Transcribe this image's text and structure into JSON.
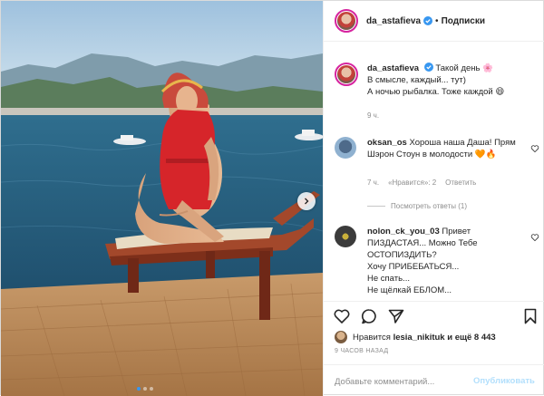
{
  "post": {
    "username": "da_astafieva",
    "separator": "•",
    "follow_label": "Подписки",
    "caption": {
      "username": "da_astafieva",
      "text_line1": "Такой день",
      "text_line2": "В смысле, каждый... тут)",
      "text_line3": "А ночью рыбалка. Тоже каждой",
      "time": "9 ч."
    },
    "comments": [
      {
        "username": "oksan_os",
        "text": "Хороша наша Даша! Прям Шэрон Стоун в молодости",
        "time": "7 ч.",
        "likes": "«Нравится»: 2",
        "reply": "Ответить",
        "view_replies": "Посмотреть ответы (1)"
      },
      {
        "username": "nolon_ck_you_03",
        "line1": "Привет",
        "line2": "ПИЗДАСТАЯ... Можно Тебе",
        "line3": "ОСТОПИЗДИТЬ?",
        "line4": "Хочу ПРИБЕБАТЬСЯ...",
        "line5": "Не спать...",
        "line6": "Не щёлкай ЕБЛОМ..."
      }
    ],
    "likes_text_prefix": "Нравится",
    "likes_user": "lesia_nikituk",
    "likes_rest": "и ещё 8 443",
    "post_time": "9 ЧАСОВ НАЗАД",
    "add_comment_placeholder": "Добавьте комментарий...",
    "publish_label": "Опубликовать"
  },
  "icons": {
    "verified": "verified-badge-icon",
    "like": "heart-icon",
    "comment": "comment-icon",
    "share": "paper-plane-icon",
    "save": "bookmark-icon",
    "next": "chevron-right-icon",
    "emoji_flower": "🌸",
    "emoji_laugh": "😄",
    "emoji_hearts": "🧡🔥"
  },
  "colors": {
    "accent": "#3897f0",
    "verified": "#3897f0",
    "publish_disabled": "#b2dffc",
    "meta_gray": "#8e8e8e"
  },
  "carousel": {
    "total": 3,
    "active": 1
  }
}
